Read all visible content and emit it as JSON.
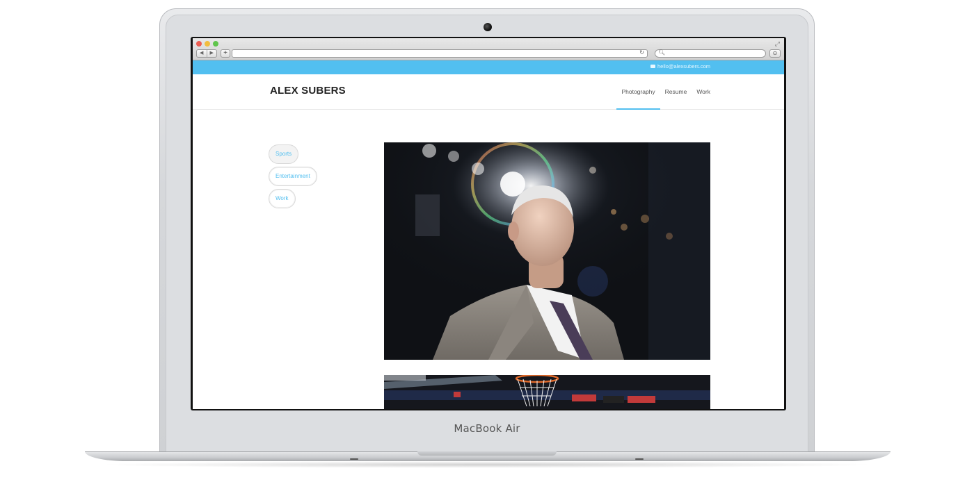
{
  "device": {
    "brand_label": "MacBook Air"
  },
  "browser": {
    "url": "",
    "search_placeholder": "",
    "back_glyph": "◀",
    "forward_glyph": "▶",
    "add_glyph": "+",
    "reload_glyph": "↻",
    "search_glyph": "🔍︎",
    "share_glyph": "⊙"
  },
  "site": {
    "accent_color": "#52bff0",
    "topbar": {
      "email": "hello@alexsubers.com"
    },
    "header": {
      "logo": "ALEX SUBERS",
      "nav": [
        {
          "label": "Photography",
          "active": true
        },
        {
          "label": "Resume",
          "active": false
        },
        {
          "label": "Work",
          "active": false
        }
      ]
    },
    "categories": [
      {
        "label": "Sports",
        "selected": true
      },
      {
        "label": "Entertainment",
        "selected": false
      },
      {
        "label": "Work",
        "selected": false
      }
    ],
    "photos": [
      {
        "subject": "coach-portrait-photo"
      },
      {
        "subject": "basketball-hoop-photo"
      }
    ]
  }
}
